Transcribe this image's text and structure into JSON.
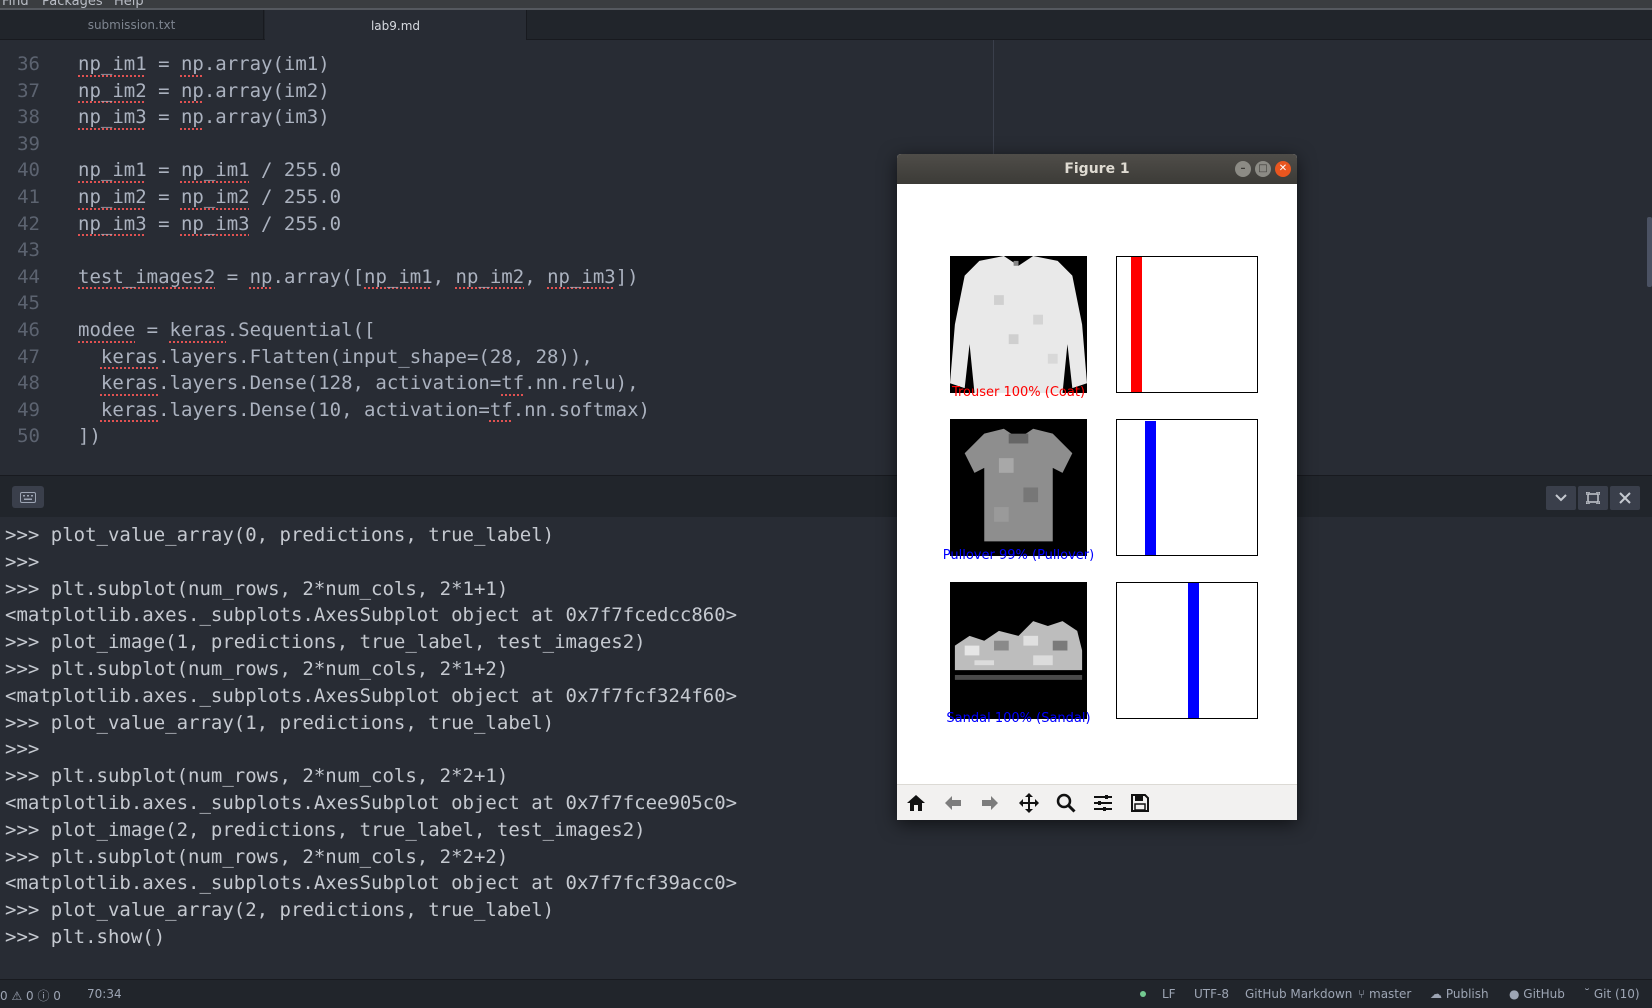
{
  "menubar": {
    "items": [
      "Find",
      "Packages",
      "Help"
    ]
  },
  "tabs": [
    {
      "label": "submission.txt",
      "active": false
    },
    {
      "label": "lab9.md",
      "active": true
    }
  ],
  "editor": {
    "lines": [
      {
        "n": "36",
        "code": "np_im1 = np.array(im1)"
      },
      {
        "n": "37",
        "code": "np_im2 = np.array(im2)"
      },
      {
        "n": "38",
        "code": "np_im3 = np.array(im3)"
      },
      {
        "n": "39",
        "code": ""
      },
      {
        "n": "40",
        "code": "np_im1 = np_im1 / 255.0"
      },
      {
        "n": "41",
        "code": "np_im2 = np_im2 / 255.0"
      },
      {
        "n": "42",
        "code": "np_im3 = np_im3 / 255.0"
      },
      {
        "n": "43",
        "code": ""
      },
      {
        "n": "44",
        "code": "test_images2 = np.array([np_im1, np_im2, np_im3])"
      },
      {
        "n": "45",
        "code": ""
      },
      {
        "n": "46",
        "code": "modee = keras.Sequential(["
      },
      {
        "n": "47",
        "code": "  keras.layers.Flatten(input_shape=(28, 28)),"
      },
      {
        "n": "48",
        "code": "  keras.layers.Dense(128, activation=tf.nn.relu),"
      },
      {
        "n": "49",
        "code": "  keras.layers.Dense(10, activation=tf.nn.softmax)"
      },
      {
        "n": "50",
        "code": "])"
      }
    ]
  },
  "terminal": {
    "lines": [
      ">>> plot_value_array(0, predictions, true_label)",
      ">>>",
      ">>> plt.subplot(num_rows, 2*num_cols, 2*1+1)",
      "<matplotlib.axes._subplots.AxesSubplot object at 0x7f7fcedcc860>",
      ">>> plot_image(1, predictions, true_label, test_images2)",
      ">>> plt.subplot(num_rows, 2*num_cols, 2*1+2)",
      "<matplotlib.axes._subplots.AxesSubplot object at 0x7f7fcf324f60>",
      ">>> plot_value_array(1, predictions, true_label)",
      ">>>",
      ">>> plt.subplot(num_rows, 2*num_cols, 2*2+1)",
      "<matplotlib.axes._subplots.AxesSubplot object at 0x7f7fcee905c0>",
      ">>> plot_image(2, predictions, true_label, test_images2)",
      ">>> plt.subplot(num_rows, 2*num_cols, 2*2+2)",
      "<matplotlib.axes._subplots.AxesSubplot object at 0x7f7fcf39acc0>",
      ">>> plot_value_array(2, predictions, true_label)",
      ">>> plt.show()"
    ]
  },
  "status": {
    "diagnostics": "0 ⚠ 0 ⓘ 0",
    "cursor": "70:34",
    "line_ending": "LF",
    "encoding": "UTF-8",
    "grammar": "GitHub Markdown",
    "branch": "master",
    "publish": "Publish",
    "github": "GitHub",
    "git": "Git (10)"
  },
  "figure": {
    "title": "Figure 1",
    "subplots": [
      {
        "caption": "Trouser 100% (Coat)",
        "caption_color": "#ff0000",
        "bar_color": "#ff0000",
        "bar_class_index": 1,
        "bar_value": 1.0,
        "garment": "coat"
      },
      {
        "caption": "Pullover 99% (Pullover)",
        "caption_color": "#0000ff",
        "bar_color": "#0000ff",
        "bar_class_index": 2,
        "bar_value": 0.99,
        "garment": "pullover"
      },
      {
        "caption": "Sandal 100% (Sandal)",
        "caption_color": "#0000ff",
        "bar_color": "#0000ff",
        "bar_class_index": 5,
        "bar_value": 1.0,
        "garment": "shoe"
      }
    ],
    "toolbar": [
      "home-icon",
      "back-arrow-icon",
      "forward-arrow-icon",
      "pan-icon",
      "zoom-icon",
      "configure-subplots-icon",
      "save-icon"
    ]
  }
}
